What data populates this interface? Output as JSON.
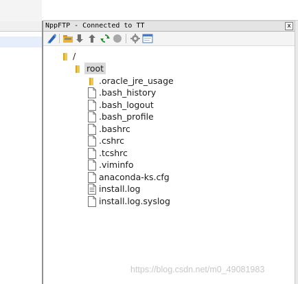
{
  "panel": {
    "title": "NppFTP - Connected to TT",
    "close_label": "x"
  },
  "toolbar": [
    {
      "name": "connect-icon"
    },
    {
      "name": "open-directory-icon"
    },
    {
      "name": "download-icon"
    },
    {
      "name": "upload-icon"
    },
    {
      "name": "refresh-icon"
    },
    {
      "name": "abort-icon"
    },
    {
      "name": "settings-icon"
    },
    {
      "name": "messages-window-icon"
    }
  ],
  "tree": {
    "root_dir": "/",
    "home_dir": "root",
    "items": [
      {
        "label": ".oracle_jre_usage",
        "kind": "folder"
      },
      {
        "label": ".bash_history",
        "kind": "file"
      },
      {
        "label": ".bash_logout",
        "kind": "file"
      },
      {
        "label": ".bash_profile",
        "kind": "file"
      },
      {
        "label": ".bashrc",
        "kind": "file"
      },
      {
        "label": ".cshrc",
        "kind": "file"
      },
      {
        "label": ".tcshrc",
        "kind": "file"
      },
      {
        "label": ".viminfo",
        "kind": "file"
      },
      {
        "label": "anaconda-ks.cfg",
        "kind": "file"
      },
      {
        "label": "install.log",
        "kind": "text-file"
      },
      {
        "label": "install.log.syslog",
        "kind": "file"
      }
    ]
  },
  "watermark": "https://blog.csdn.net/m0_49081983",
  "colors": {
    "folder": "#f2c84b",
    "selection": "#d9d9d9",
    "title_bar": "#e4e4e4"
  }
}
